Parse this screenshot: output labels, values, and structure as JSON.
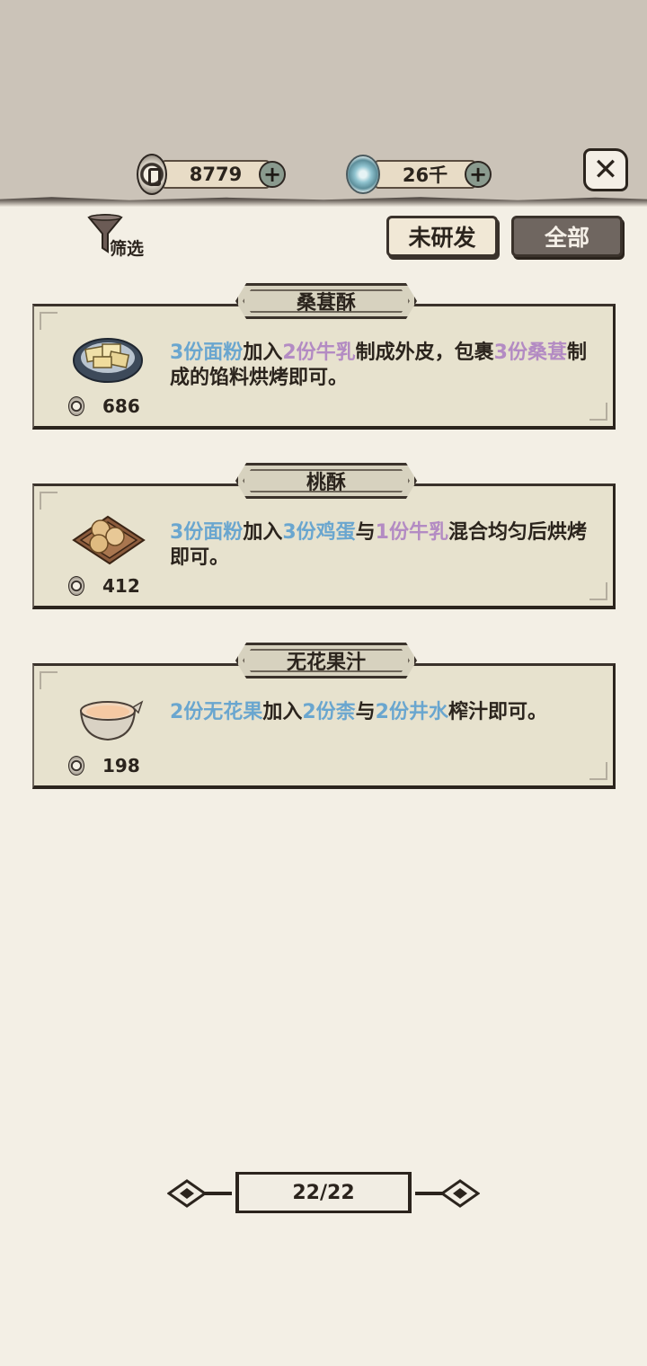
{
  "header": {
    "coins": {
      "icon": "coin-icon",
      "value": "8779"
    },
    "jade": {
      "icon": "swirl-icon",
      "value": "26千"
    },
    "close_icon": "close-icon"
  },
  "filter": {
    "label": "筛选",
    "icon": "funnel-icon"
  },
  "tabs": [
    {
      "label": "未研发",
      "active": false
    },
    {
      "label": "全部",
      "active": true
    }
  ],
  "recipes": [
    {
      "name": "桑葚酥",
      "price": "686",
      "dish_icon": "pastry-plate-icon",
      "desc_parts": [
        {
          "t": "3份面粉",
          "c": "blue"
        },
        {
          "t": "加入",
          "c": ""
        },
        {
          "t": "2份牛乳",
          "c": "purple"
        },
        {
          "t": "制成外皮，包裹",
          "c": ""
        },
        {
          "t": "3份桑葚",
          "c": "purple"
        },
        {
          "t": "制成的馅料烘烤即可。",
          "c": ""
        }
      ]
    },
    {
      "name": "桃酥",
      "price": "412",
      "dish_icon": "cookie-tray-icon",
      "desc_parts": [
        {
          "t": "3份面粉",
          "c": "blue"
        },
        {
          "t": "加入",
          "c": ""
        },
        {
          "t": "3份鸡蛋",
          "c": "blue"
        },
        {
          "t": "与",
          "c": ""
        },
        {
          "t": "1份牛乳",
          "c": "purple"
        },
        {
          "t": "混合均匀后烘烤即可。",
          "c": ""
        }
      ]
    },
    {
      "name": "无花果汁",
      "price": "198",
      "dish_icon": "juice-bowl-icon",
      "desc_parts": [
        {
          "t": "2份无花果",
          "c": "blue"
        },
        {
          "t": "加入",
          "c": ""
        },
        {
          "t": "2份柰",
          "c": "blue"
        },
        {
          "t": "与",
          "c": ""
        },
        {
          "t": "2份井水",
          "c": "blue"
        },
        {
          "t": "榨汁即可。",
          "c": ""
        }
      ]
    }
  ],
  "pager": {
    "text": "22/22"
  },
  "colors": {
    "highlight_blue": "#6aa6cf",
    "highlight_purple": "#b38bc3",
    "background": "#f3efe5",
    "card_bg": "#e7e2ce"
  }
}
